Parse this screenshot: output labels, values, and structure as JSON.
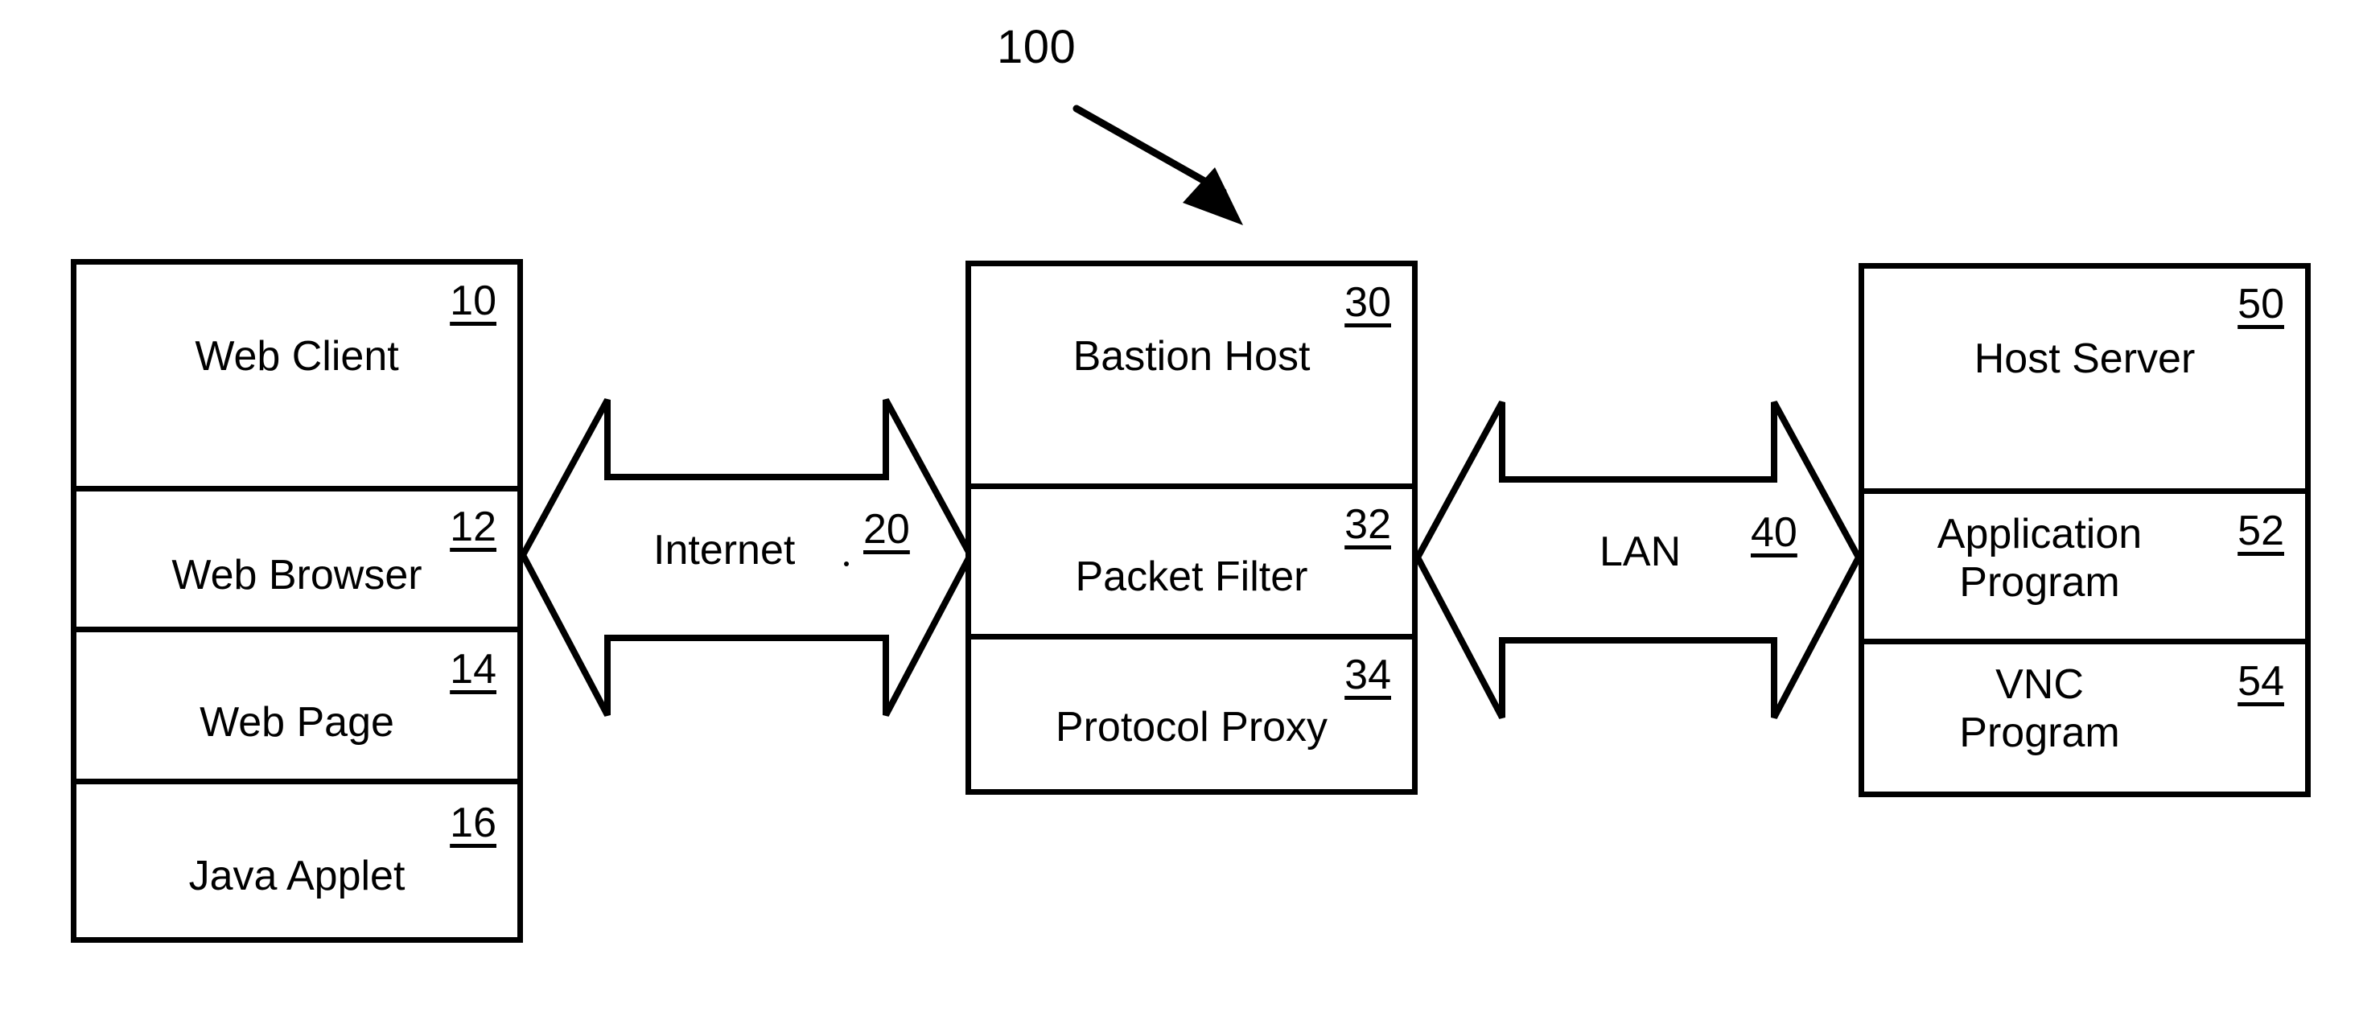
{
  "figure": {
    "number": "100",
    "leader_arrow": "diagonal-arrow-down-right"
  },
  "nodes": [
    {
      "id": "web-client",
      "name": "web-client-box",
      "rows": [
        {
          "label": "Web Client",
          "ref": "10",
          "name": "web-client-row"
        },
        {
          "label": "Web Browser",
          "ref": "12",
          "name": "web-browser-row"
        },
        {
          "label": "Web Page",
          "ref": "14",
          "name": "web-page-row"
        },
        {
          "label": "Java Applet",
          "ref": "16",
          "name": "java-applet-row"
        }
      ]
    },
    {
      "id": "bastion-host",
      "name": "bastion-host-box",
      "rows": [
        {
          "label": "Bastion Host",
          "ref": "30",
          "name": "bastion-host-row"
        },
        {
          "label": "Packet Filter",
          "ref": "32",
          "name": "packet-filter-row"
        },
        {
          "label": "Protocol Proxy",
          "ref": "34",
          "name": "protocol-proxy-row"
        }
      ]
    },
    {
      "id": "host-server",
      "name": "host-server-box",
      "rows": [
        {
          "label": "Host Server",
          "ref": "50",
          "name": "host-server-row"
        },
        {
          "label": "Application\nProgram",
          "ref": "52",
          "name": "application-program-row"
        },
        {
          "label": "VNC\nProgram",
          "ref": "54",
          "name": "vnc-program-row"
        }
      ]
    }
  ],
  "connectors": [
    {
      "id": "internet",
      "label": "Internet",
      "ref": "20",
      "name": "internet-connector"
    },
    {
      "id": "lan",
      "label": "LAN",
      "ref": "40",
      "name": "lan-connector"
    }
  ],
  "colors": {
    "stroke": "#000000",
    "background": "#ffffff"
  }
}
